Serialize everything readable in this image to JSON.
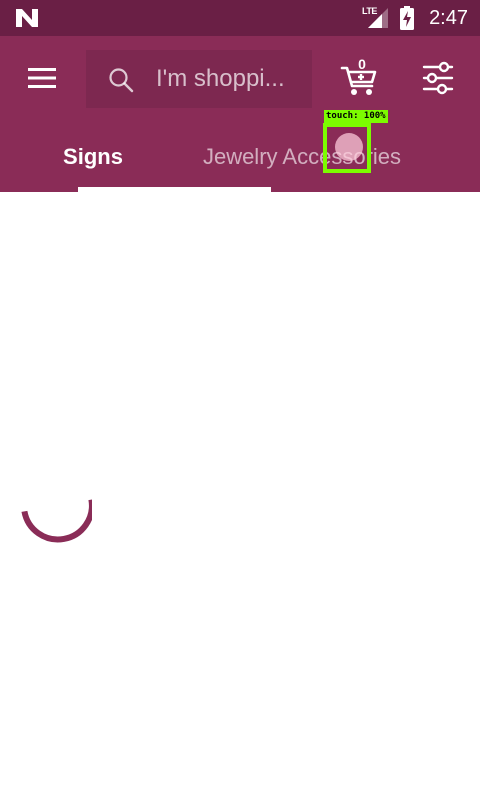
{
  "status_bar": {
    "network_type": "LTE",
    "time": "2:47",
    "icons": [
      "n-logo-icon",
      "signal-icon",
      "battery-charging-icon"
    ],
    "background_color": "#6a1f45"
  },
  "app_bar": {
    "background_color": "#8a2c57",
    "menu_icon": "hamburger-menu-icon",
    "search": {
      "placeholder": "I'm shoppi...",
      "icon": "search-icon"
    },
    "cart": {
      "count": "0",
      "icon": "shopping-cart-icon"
    },
    "filter_icon": "sliders-filter-icon"
  },
  "tabs": [
    {
      "label": "Signs",
      "selected": true
    },
    {
      "label": "Jewelry Accessories",
      "selected": false
    }
  ],
  "touch_overlay": {
    "label": "touch: 100%"
  },
  "content": {
    "loading": true,
    "accent_color": "#8a2c57"
  }
}
